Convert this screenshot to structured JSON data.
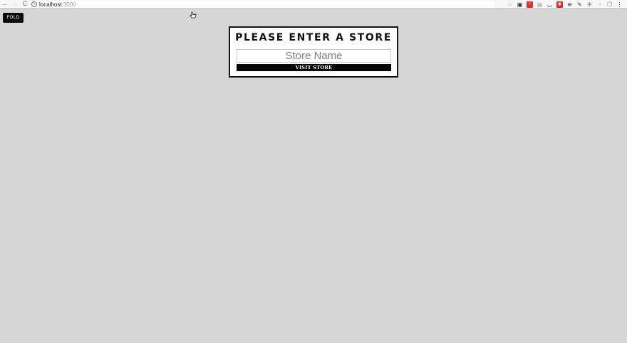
{
  "browser": {
    "back_glyph": "←",
    "forward_glyph": "→",
    "reload_glyph": "C",
    "info_glyph": "i",
    "url_host": "localhost",
    "url_port": ":3000",
    "extensions": [
      {
        "icon": "star-icon",
        "glyph": "☆"
      },
      {
        "icon": "extension-icon",
        "glyph": "▣"
      },
      {
        "icon": "extension-red-icon",
        "glyph": "▪"
      },
      {
        "icon": "extension-icon",
        "glyph": "▤"
      },
      {
        "icon": "pocket-icon",
        "glyph": "◡"
      },
      {
        "icon": "shield-icon",
        "glyph": "◆"
      },
      {
        "icon": "layers-icon",
        "glyph": "≋"
      },
      {
        "icon": "eyedropper-icon",
        "glyph": "✎"
      },
      {
        "icon": "puzzle-icon",
        "glyph": "✚"
      },
      {
        "icon": "timer-icon",
        "glyph": "◔"
      },
      {
        "icon": "copy-icon",
        "glyph": "❐"
      },
      {
        "icon": "menu-icon",
        "glyph": "⋮"
      }
    ]
  },
  "page": {
    "fold_label": "FOLD",
    "store_form": {
      "title": "PLEASE ENTER A STORE",
      "input_placeholder": "Store Name",
      "input_value": "",
      "submit_label": "VISIT STORE"
    }
  },
  "colors": {
    "page_background": "#d6d6d6",
    "panel_border": "#151515",
    "button_background": "#050505"
  }
}
